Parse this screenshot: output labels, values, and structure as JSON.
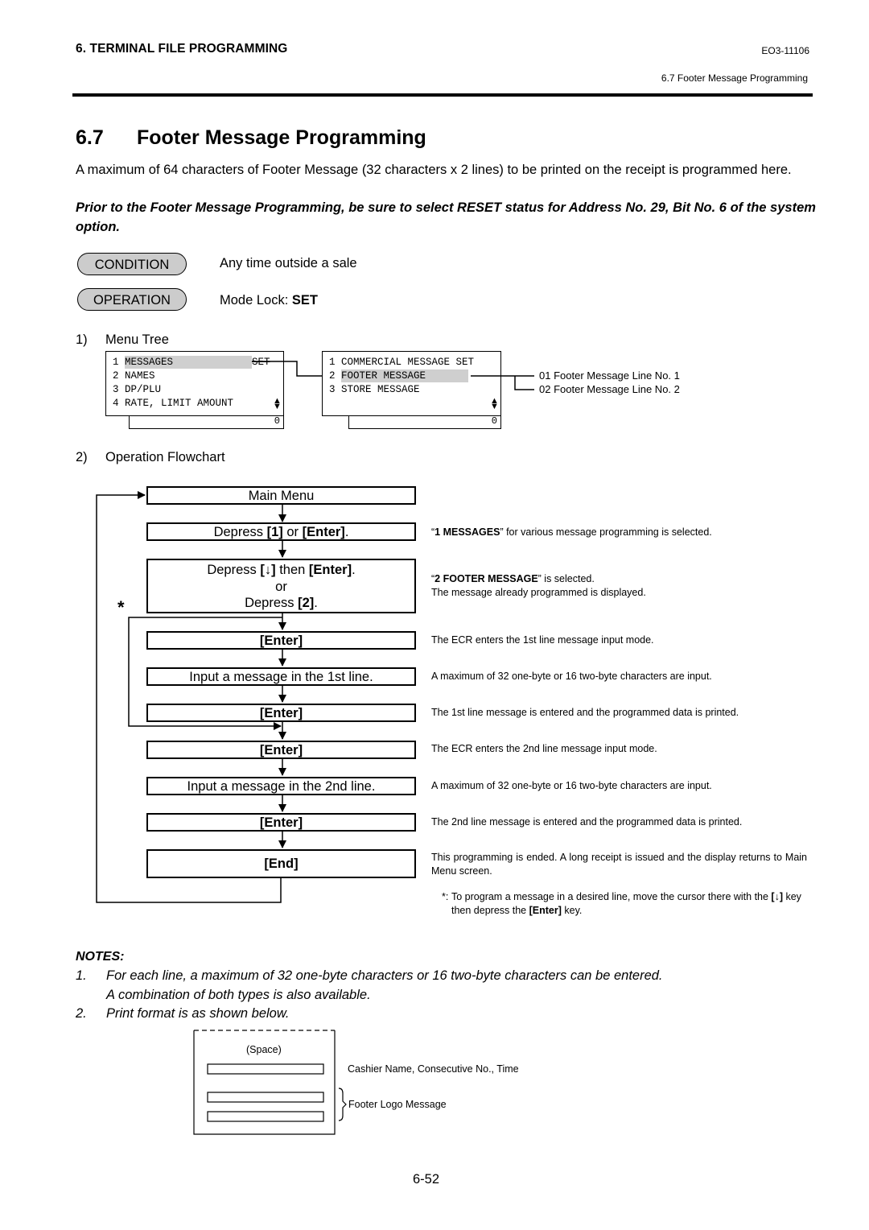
{
  "header": {
    "section": "6. TERMINAL FILE PROGRAMMING",
    "doc_number": "EO3-11106",
    "subsection": "6.7 Footer Message Programming"
  },
  "title": {
    "number": "6.7",
    "text": "Footer Message Programming"
  },
  "intro": "A maximum of 64 characters of Footer Message (32 characters x 2 lines) to be printed on the receipt is programmed here.",
  "warning": "Prior to the Footer Message Programming, be sure to select RESET status for Address No. 29, Bit No. 6 of the system option.",
  "condition": {
    "label": "CONDITION",
    "text": "Any time outside a sale"
  },
  "operation": {
    "label": "OPERATION",
    "text_prefix": "Mode Lock: ",
    "text_bold": "SET"
  },
  "menu_tree": {
    "step_number": "1)",
    "title": "Menu Tree",
    "screen1": {
      "lines": [
        {
          "num": "1",
          "label": "MESSAGES",
          "suffix": "SET",
          "highlighted": true
        },
        {
          "num": "2",
          "label": "NAMES",
          "suffix": "",
          "highlighted": false
        },
        {
          "num": "3",
          "label": "DP/PLU",
          "suffix": "",
          "highlighted": false
        },
        {
          "num": "4",
          "label": "RATE, LIMIT AMOUNT",
          "suffix": "",
          "highlighted": false
        }
      ],
      "footer_value": "0"
    },
    "screen2": {
      "lines": [
        {
          "num": "1",
          "label": "COMMERCIAL MESSAGE SET",
          "suffix": "",
          "highlighted": false
        },
        {
          "num": "2",
          "label": "FOOTER MESSAGE",
          "suffix": "",
          "highlighted": true
        },
        {
          "num": "3",
          "label": "STORE MESSAGE",
          "suffix": "",
          "highlighted": false
        }
      ],
      "footer_value": "0"
    },
    "branches": [
      "01 Footer Message Line No. 1",
      "02 Footer Message Line No. 2"
    ]
  },
  "flowchart": {
    "step_number": "2)",
    "title": "Operation Flowchart",
    "asterisk": "*",
    "boxes": {
      "main_menu": "Main Menu",
      "b2_pre": "Depress ",
      "b2_k1": "[1]",
      "b2_mid": " or ",
      "b2_k2": "[Enter]",
      "b2_post": ".",
      "b3_l1_pre": "Depress ",
      "b3_l1_k1": "[↓]",
      "b3_l1_mid": " then ",
      "b3_l1_k2": "[Enter]",
      "b3_l1_post": ".",
      "b3_or": "or",
      "b3_l3_pre": "Depress ",
      "b3_l3_k": "[2]",
      "b3_l3_post": ".",
      "enter1": "[Enter]",
      "input1": "Input a message in the 1st line.",
      "enter2": "[Enter]",
      "enter3": "[Enter]",
      "input2": "Input a message in the 2nd line.",
      "enter4": "[Enter]",
      "end": "[End]"
    },
    "descriptions": {
      "d1_q1": "“",
      "d1_bold": "1 MESSAGES",
      "d1_rest": "” for various message programming is selected.",
      "d2_q1": "“",
      "d2_bold": "2 FOOTER MESSAGE",
      "d2_rest": "” is selected.",
      "d2_line2": "The message already programmed is displayed.",
      "d3": "The ECR enters the 1st line message input mode.",
      "d4": "A maximum of 32 one-byte or 16 two-byte characters are input.",
      "d5": "The 1st line message is entered and the programmed data is printed.",
      "d6": "The ECR enters the 2nd line message input mode.",
      "d7": "A maximum of 32 one-byte or 16 two-byte characters are input.",
      "d8": "The 2nd line message is entered and the programmed data is printed.",
      "d9": "This programming is ended.  A long receipt is issued and the display returns to Main Menu screen.",
      "footnote_mark": "*:",
      "fn_pre": "To program a message in a desired line, move the cursor there with the ",
      "fn_k1": "[↓]",
      "fn_mid": " key then depress the ",
      "fn_k2": "[Enter]",
      "fn_post": " key."
    }
  },
  "notes": {
    "title": "NOTES:",
    "items": [
      {
        "num": "1.",
        "line1": "For each line, a maximum of 32 one-byte characters or 16 two-byte characters can be entered.",
        "line2": "A combination of both types is also available."
      },
      {
        "num": "2.",
        "line1": "Print format is as shown below."
      }
    ]
  },
  "receipt": {
    "space_label": "(Space)",
    "label_cashier": "Cashier Name, Consecutive No., Time",
    "label_footer": "Footer Logo Message"
  },
  "page_number": "6-52"
}
